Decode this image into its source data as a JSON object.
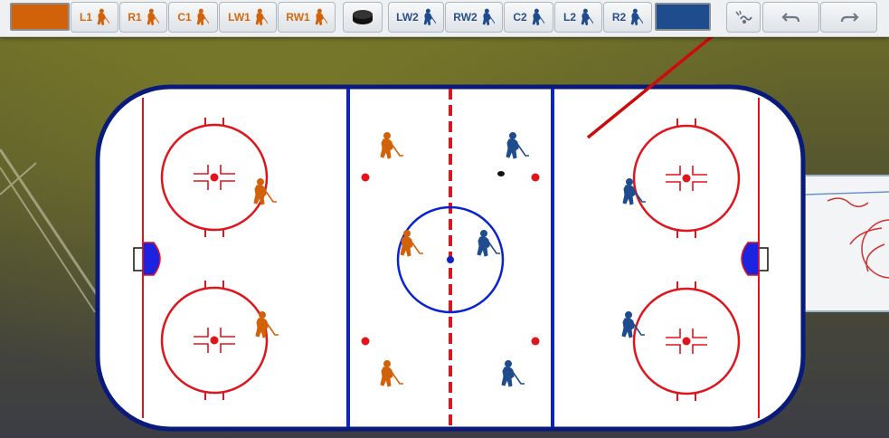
{
  "toolbar": {
    "home_team_color": "#d2620a",
    "away_team_color": "#1e4c8c",
    "home_players": [
      {
        "label": "L1"
      },
      {
        "label": "R1"
      },
      {
        "label": "C1"
      },
      {
        "label": "LW1"
      },
      {
        "label": "RW1"
      }
    ],
    "puck_button": {
      "icon": "puck-icon"
    },
    "away_players": [
      {
        "label": "LW2"
      },
      {
        "label": "RW2"
      },
      {
        "label": "C2"
      },
      {
        "label": "L2"
      },
      {
        "label": "R2"
      }
    ],
    "draw_tool": {
      "icon": "draw-path-icon"
    },
    "undo": {
      "icon": "undo-icon"
    },
    "redo": {
      "icon": "redo-icon"
    }
  },
  "rink": {
    "board_color": "#0a1a7a",
    "red_line_color": "#e0141c",
    "blue_line_color": "#0a22d0",
    "ice_color": "#ffffff"
  },
  "annotation": {
    "arrow_color": "#cc0b0b",
    "points_to": "draw-path-button"
  }
}
